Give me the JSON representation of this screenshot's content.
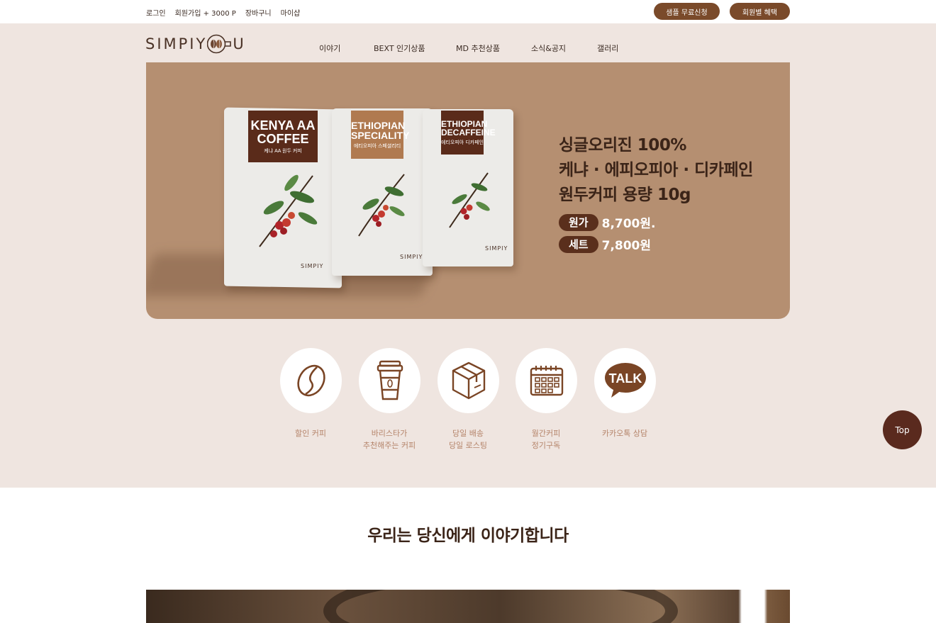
{
  "topbar": {
    "links": [
      "로그인",
      "회원가입 + 3000 P",
      "장바구니",
      "마이샵"
    ],
    "sample_button": "샘플 무료신청",
    "benefit_button": "회원별 혜택"
  },
  "logo": {
    "text": "SIMPIY",
    "suffix": "U"
  },
  "nav": {
    "items": [
      "이야기",
      "BEXT 인기상품",
      "MD 추천상품",
      "소식&공지",
      "갤러리"
    ]
  },
  "hero": {
    "bags": [
      {
        "title_line1": "KENYA AA",
        "title_line2": "COFFEE",
        "subtitle": "케냐 AA 원두 커피",
        "logo": "SIMPIY"
      },
      {
        "title_line1": "ETHIOPIAN",
        "title_line2": "SPECIALITY",
        "subtitle": "에티오피아 스페셜리티",
        "logo": "SIMPIY"
      },
      {
        "title_line1": "ETHIOPIAN",
        "title_line2": "DECAFFEINE",
        "subtitle": "에티오피아 디카페인",
        "logo": "SIMPIY"
      }
    ],
    "line1": "싱글오리진 100%",
    "line2": "케냐 · 에피오피아 · 디카페인",
    "line3": "원두커피 용량 10g",
    "price_label": "원가",
    "price_value": "8,700원.",
    "set_label": "세트",
    "set_value": "7,800원"
  },
  "services": [
    {
      "icon": "coffee-bean-icon",
      "line1": "할인 커피",
      "line2": ""
    },
    {
      "icon": "coffee-cup-icon",
      "line1": "바리스타가",
      "line2": "추천해주는 커피"
    },
    {
      "icon": "package-box-icon",
      "line1": "당일 배송",
      "line2": "당일 로스팅"
    },
    {
      "icon": "calendar-icon",
      "line1": "월간커피",
      "line2": "정기구독"
    },
    {
      "icon": "kakao-talk-icon",
      "line1": "카카오톡 상담",
      "line2": "",
      "talk_text": "TALK"
    }
  ],
  "top_button": "Top",
  "story": {
    "title": "우리는 당신에게 이야기합니다"
  },
  "colors": {
    "accent": "#7a4a2a",
    "beige": "#efe5e0",
    "hero_bg": "#b58f71",
    "dark_brown": "#5a2a1e",
    "icon_brown": "#7a4525"
  }
}
